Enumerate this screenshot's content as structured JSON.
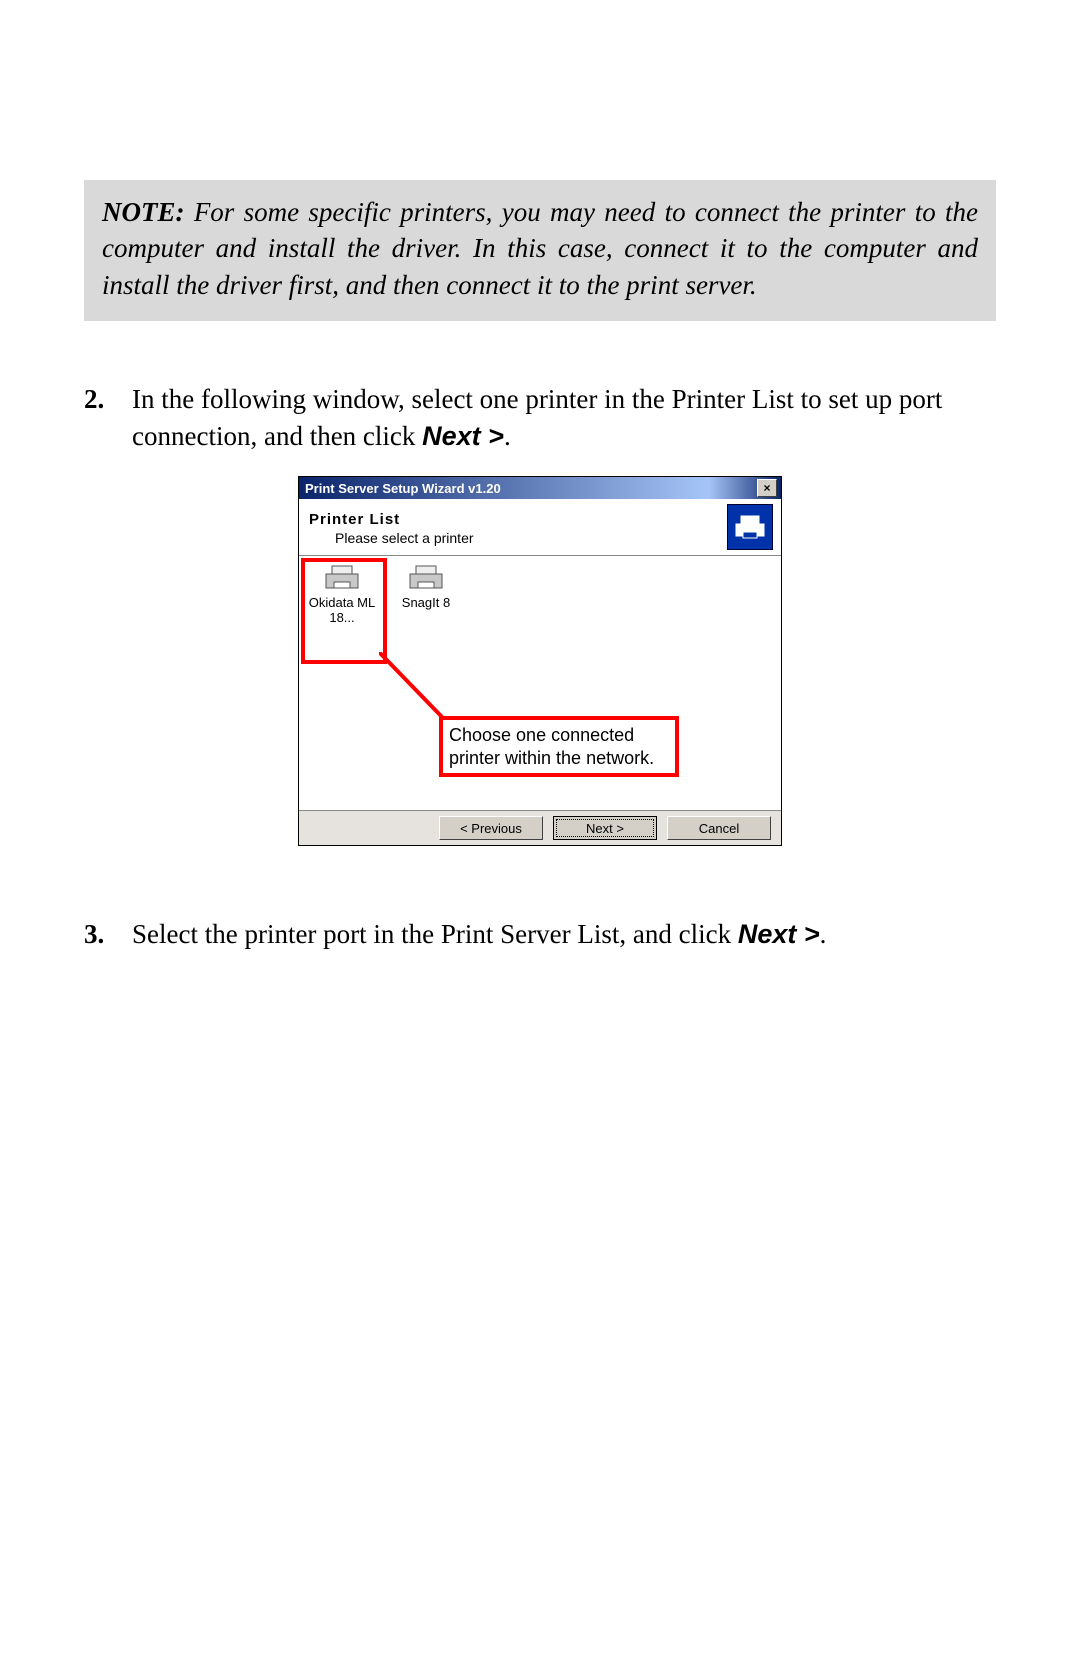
{
  "note": {
    "label": "NOTE:",
    "body": "For some specific printers, you may need to connect the printer to the computer and install the driver.   In this case, connect it to the computer and install the driver first, and then connect it to the print server."
  },
  "steps": {
    "s2_num": "2.",
    "s2_a": "In the following window, select one printer in the Printer List to set up port connection, and then click ",
    "s2_b": "Next >",
    "s2_c": ".",
    "s3_num": "3.",
    "s3_a": "Select the printer port in the Print Server List, and click ",
    "s3_b": "Next >",
    "s3_c": "."
  },
  "wizard": {
    "title": "Print Server Setup Wizard v1.20",
    "close_x": "×",
    "header_line1": "Printer  List",
    "header_line2": "Please select a printer",
    "printers": {
      "p1": "Okidata ML 18...",
      "p2": "SnagIt 8"
    },
    "callout": "Choose one connected printer within the network.",
    "buttons": {
      "prev": "< Previous",
      "next": "Next >",
      "cancel": "Cancel"
    }
  }
}
